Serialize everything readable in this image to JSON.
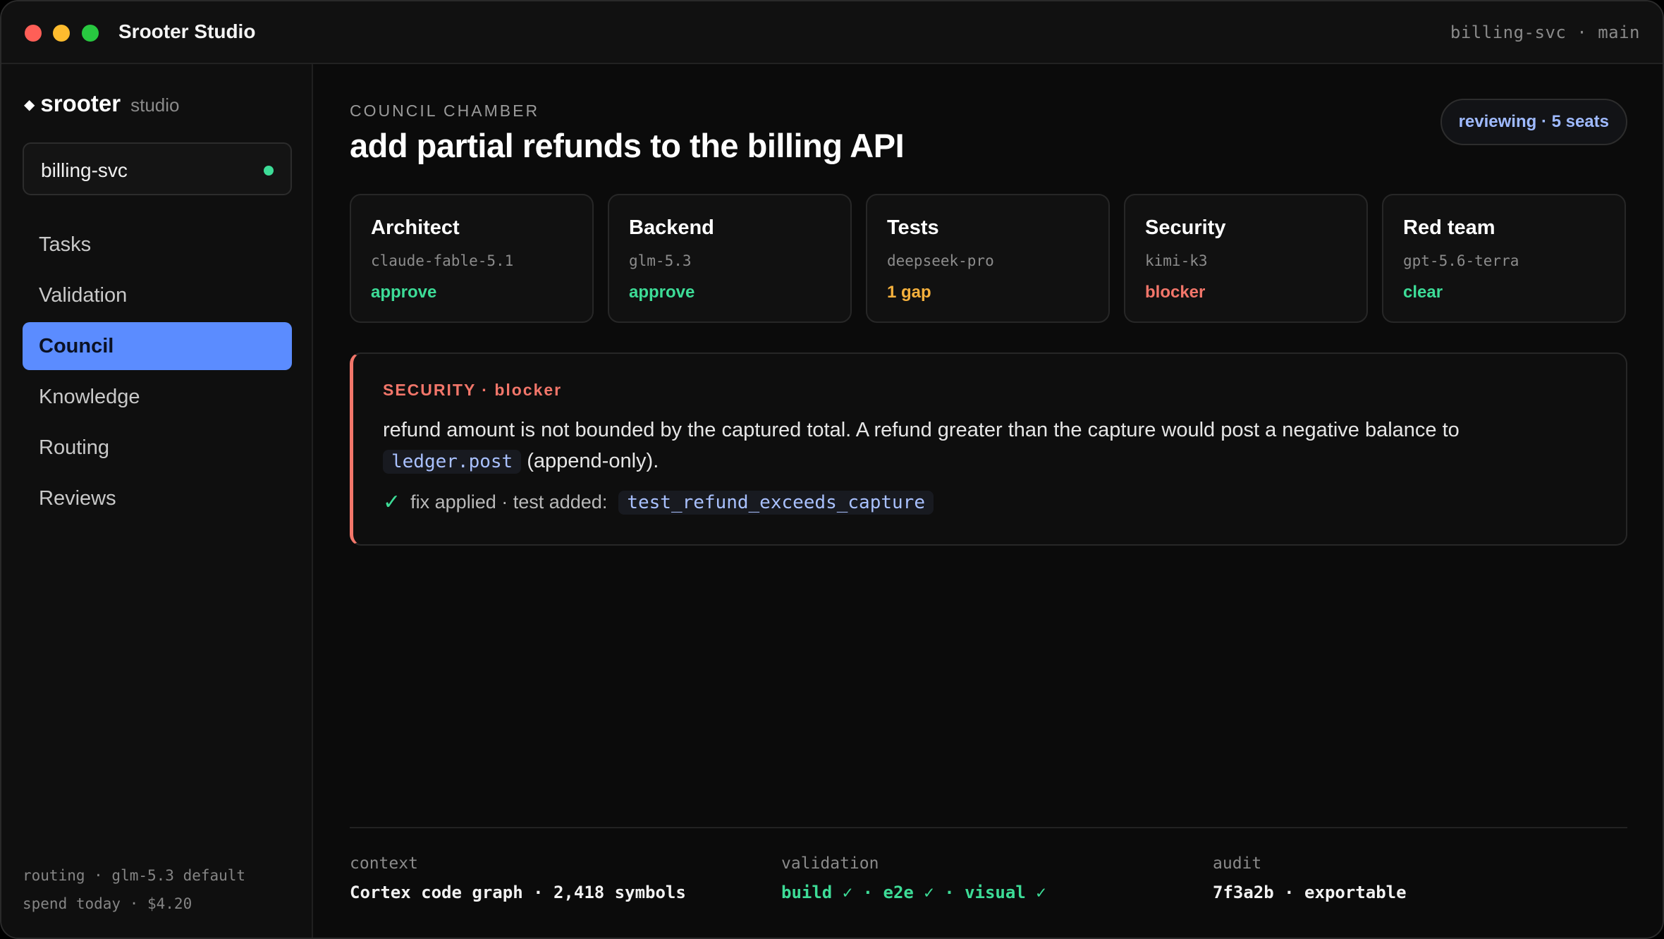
{
  "window": {
    "title": "Srooter Studio",
    "repo_branch": "billing-svc · main"
  },
  "sidebar": {
    "brand_icon": "◆",
    "brand_name": "srooter",
    "brand_sub": "studio",
    "project": "billing-svc",
    "project_status_color": "#3ddc97",
    "items": [
      {
        "label": "Tasks"
      },
      {
        "label": "Validation"
      },
      {
        "label": "Council"
      },
      {
        "label": "Knowledge"
      },
      {
        "label": "Routing"
      },
      {
        "label": "Reviews"
      }
    ],
    "active_item": "Council",
    "footer": {
      "routing": "routing · glm-5.3 default",
      "spend": "spend today · $4.20"
    }
  },
  "main": {
    "eyebrow": "COUNCIL CHAMBER",
    "title": "add partial refunds to the billing API",
    "status_pill": "reviewing · 5 seats",
    "seats": [
      {
        "role": "Architect",
        "model": "claude-fable-5.1",
        "verdict": "approve",
        "color": "#3ddc97"
      },
      {
        "role": "Backend",
        "model": "glm-5.3",
        "verdict": "approve",
        "color": "#3ddc97"
      },
      {
        "role": "Tests",
        "model": "deepseek-pro",
        "verdict": "1 gap",
        "color": "#f5b13d"
      },
      {
        "role": "Security",
        "model": "kimi-k3",
        "verdict": "blocker",
        "color": "#f2766a"
      },
      {
        "role": "Red team",
        "model": "gpt-5.6-terra",
        "verdict": "clear",
        "color": "#3ddc97"
      }
    ],
    "finding": {
      "header": "SECURITY · blocker",
      "body_text": "refund amount is not bounded by the captured total. A refund greater than the capture would post a negative balance to",
      "code_ref": "ledger.post",
      "body_suffix": "(append-only).",
      "check_icon": "✓",
      "fix_text": "fix applied · test added:",
      "test_name": "test_refund_exceeds_capture"
    },
    "footer": {
      "context_label": "context",
      "context_value": "Cortex code graph · 2,418 symbols",
      "validation_label": "validation",
      "validation_value": "build ✓ · e2e ✓ · visual ✓",
      "audit_label": "audit",
      "audit_value": "7f3a2b · exportable"
    }
  },
  "colors": {
    "accent": "#5b8cff",
    "approve": "#3ddc97",
    "gap": "#f5b13d",
    "blocker": "#f2766a"
  }
}
